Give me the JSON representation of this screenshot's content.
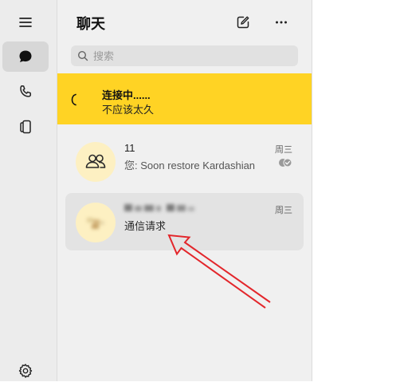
{
  "header": {
    "title": "聊天"
  },
  "search": {
    "placeholder": "搜索"
  },
  "banner": {
    "title": "连接中......",
    "subtitle": "不应该太久"
  },
  "chats": [
    {
      "name": "11",
      "message": "您: Soon restore Kardashian",
      "day": "周三",
      "status_icon": "double-check-icon"
    },
    {
      "name": "",
      "message": "通信请求",
      "day": "周三",
      "name_obscured": true
    }
  ],
  "icons": {
    "rail": [
      "menu-icon",
      "chat-bubble-icon",
      "phone-icon",
      "devices-icon",
      "gear-icon"
    ],
    "header": [
      "new-chat-icon",
      "more-icon"
    ]
  },
  "colors": {
    "banner": "#ffd324",
    "avatar_bg": "#fdf0c2",
    "annotation_arrow": "#e3262b"
  }
}
